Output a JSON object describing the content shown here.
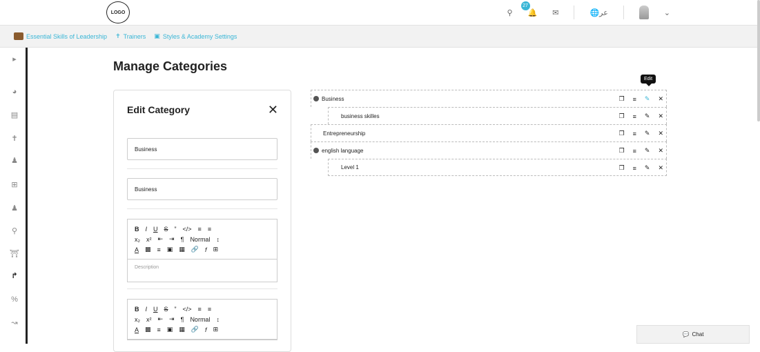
{
  "header": {
    "logo": "LOGO",
    "notifications_count": "27",
    "language": "عر"
  },
  "nav": {
    "items": [
      {
        "label": "Essential Skills of Leadership"
      },
      {
        "label": "Trainers"
      },
      {
        "label": "Styles & Academy Settings"
      }
    ]
  },
  "main": {
    "title": "Manage Categories"
  },
  "edit_category": {
    "title": "Edit Category",
    "name_en": "Business",
    "name_ar": "Business",
    "editor": {
      "normal_label": "Normal",
      "description_placeholder": "Description"
    }
  },
  "tree": {
    "tooltip": "Edit",
    "items": [
      {
        "label": "Business"
      },
      {
        "label": "business skilles"
      },
      {
        "label": "Entrepreneurship"
      },
      {
        "label": "english language"
      },
      {
        "label": "Level 1"
      }
    ]
  },
  "chat": {
    "label": "Chat"
  },
  "colors": {
    "accent": "#3ab6d6"
  }
}
